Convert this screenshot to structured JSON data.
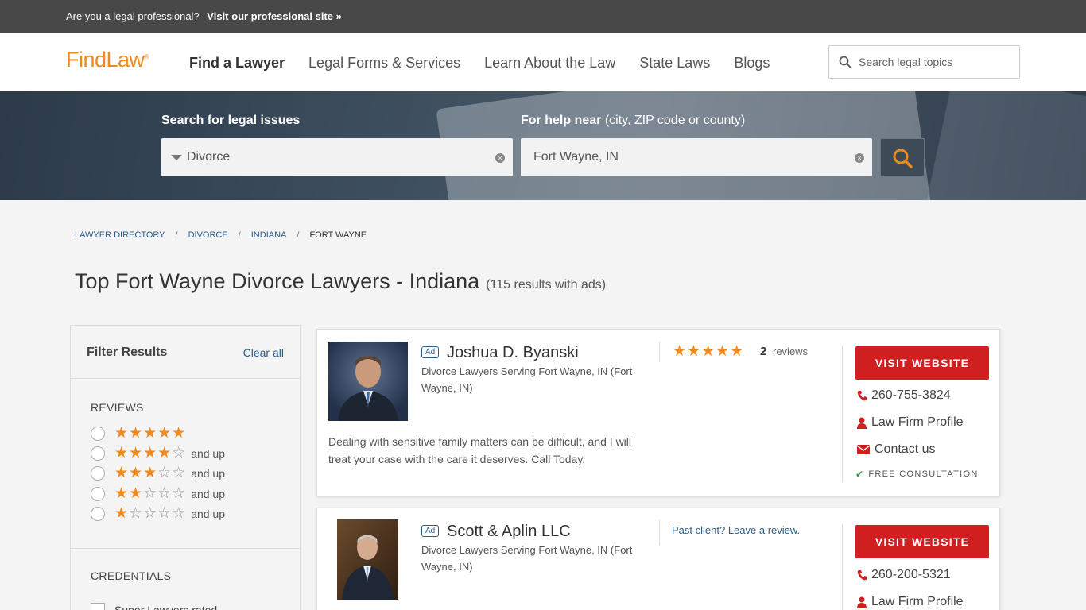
{
  "topbar": {
    "question": "Are you a legal professional?",
    "link": "Visit our professional site »"
  },
  "header": {
    "logo": "FindLaw",
    "logo_mark": "®",
    "nav": [
      "Find a Lawyer",
      "Legal Forms & Services",
      "Learn About the Law",
      "State Laws",
      "Blogs"
    ],
    "search_placeholder": "Search legal topics"
  },
  "hero": {
    "issue_label": "Search for legal issues",
    "issue_value": "Divorce",
    "location_label": "For help near",
    "location_hint": "(city, ZIP code or county)",
    "location_value": "Fort Wayne, IN",
    "clear_glyph": "×"
  },
  "breadcrumb": {
    "items": [
      "LAWYER DIRECTORY",
      "DIVORCE",
      "INDIANA"
    ],
    "current": "FORT WAYNE",
    "sep": "/"
  },
  "page": {
    "title": "Top Fort Wayne Divorce Lawyers - Indiana",
    "count": "(115 results with ads)"
  },
  "filter": {
    "title": "Filter Results",
    "clear": "Clear all",
    "reviews_label": "REVIEWS",
    "rating_levels": [
      5,
      4,
      3,
      2,
      1
    ],
    "and_up": "and up",
    "credentials_label": "CREDENTIALS",
    "credential_option": "Super Lawyers rated"
  },
  "listings": [
    {
      "ad": "Ad",
      "name": "Joshua D. Byanski",
      "serving": "Divorce Lawyers Serving Fort Wayne, IN (Fort Wayne, IN)",
      "description": "Dealing with sensitive family matters can be difficult, and I will treat your case with the care it deserves. Call Today.",
      "rating": 5,
      "review_count": "2",
      "reviews_label": "reviews",
      "visit": "VISIT WEBSITE",
      "phone": "260-755-3824",
      "profile": "Law Firm Profile",
      "contact": "Contact us",
      "free": "FREE CONSULTATION"
    },
    {
      "ad": "Ad",
      "name": "Scott & Aplin LLC",
      "serving": "Divorce Lawyers Serving Fort Wayne, IN (Fort Wayne, IN)",
      "review_prompt": "Past client? Leave a review.",
      "visit": "VISIT WEBSITE",
      "phone": "260-200-5321",
      "profile": "Law Firm Profile"
    }
  ],
  "colors": {
    "accent": "#f08a1c",
    "cta": "#d11f20",
    "link": "#2b5d8c",
    "topbar": "#484848"
  }
}
